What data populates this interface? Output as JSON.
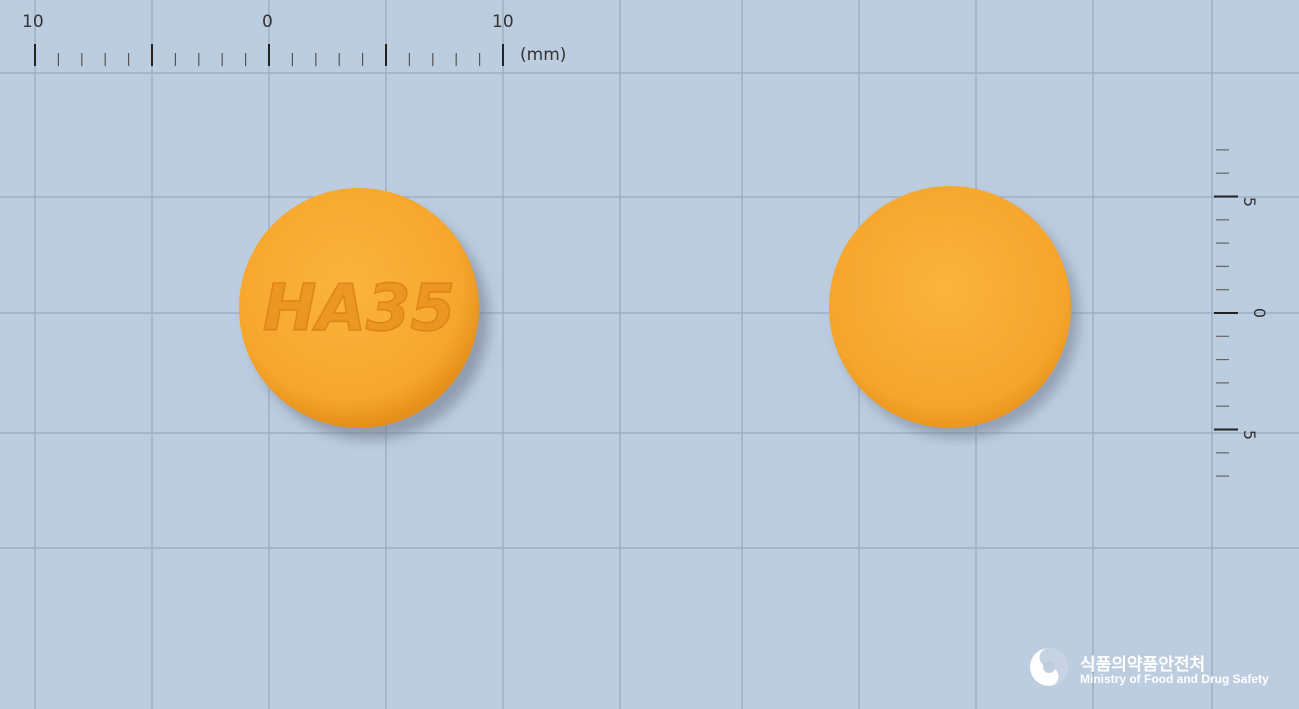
{
  "background_color": "#bccde0",
  "grid_color": "#9db0c6",
  "top_ruler": {
    "labels": [
      "10",
      "0",
      "10"
    ],
    "unit_label": "(mm)"
  },
  "side_ruler": {
    "labels": [
      "5",
      "0",
      "5"
    ]
  },
  "pills": [
    {
      "name": "pill-front",
      "imprint": "HA35",
      "color": "#f6a830"
    },
    {
      "name": "pill-back",
      "imprint": "",
      "color": "#f6a830"
    }
  ],
  "logo": {
    "org_korean": "식품의약품안전처",
    "org_english": "Ministry of Food and Drug Safety"
  }
}
